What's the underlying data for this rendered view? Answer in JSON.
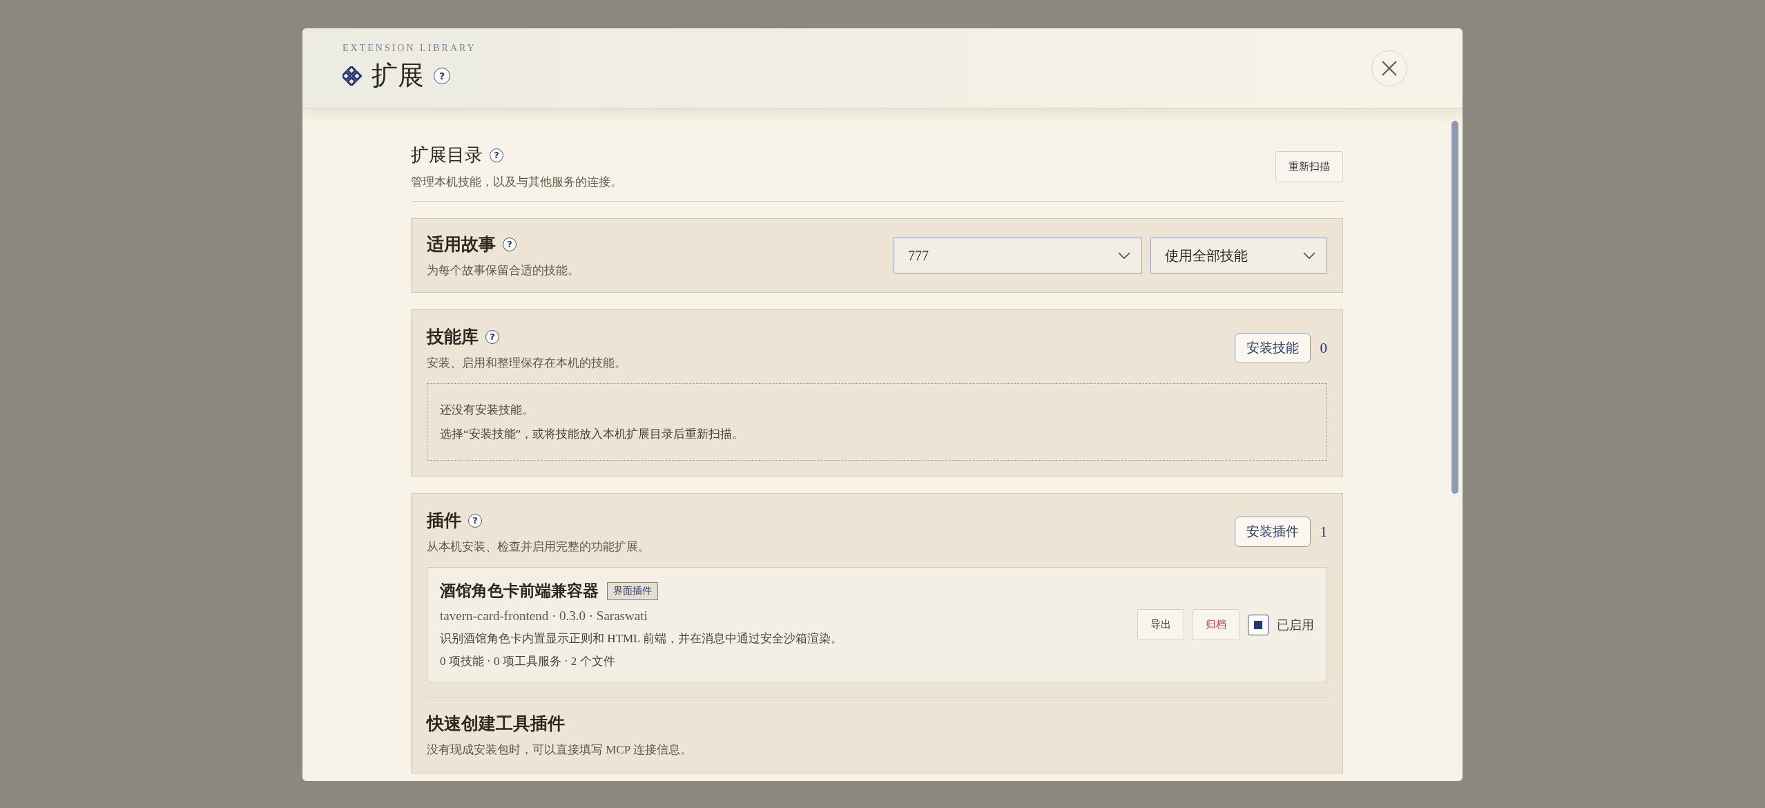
{
  "header": {
    "eyebrow": "EXTENSION LIBRARY",
    "title": "扩展",
    "help": "?"
  },
  "catalog": {
    "title": "扩展目录",
    "help": "?",
    "subtitle": "管理本机技能，以及与其他服务的连接。",
    "rescan_button": "重新扫描"
  },
  "story": {
    "title": "适用故事",
    "help": "?",
    "subtitle": "为每个故事保留合适的技能。",
    "selects": [
      {
        "value": "777"
      },
      {
        "value": "使用全部技能"
      }
    ]
  },
  "skills": {
    "title": "技能库",
    "help": "?",
    "subtitle": "安装、启用和整理保存在本机的技能。",
    "install_button": "安装技能",
    "count": "0",
    "empty": [
      "还没有安装技能。",
      "选择“安装技能”，或将技能放入本机扩展目录后重新扫描。"
    ]
  },
  "plugins": {
    "title": "插件",
    "help": "?",
    "subtitle": "从本机安装、检查并启用完整的功能扩展。",
    "install_button": "安装插件",
    "count": "1",
    "items": [
      {
        "name": "酒馆角色卡前端兼容器",
        "tag": "界面插件",
        "meta": "tavern-card-frontend · 0.3.0 · Saraswati",
        "description": "识别酒馆角色卡内置显示正则和 HTML 前端，并在消息中通过安全沙箱渲染。",
        "stats": "0 项技能 · 0 项工具服务 · 2 个文件",
        "actions": [
          {
            "label": "导出",
            "kind": "normal"
          },
          {
            "label": "归档",
            "kind": "danger"
          }
        ],
        "enabled": true,
        "status": "已启用"
      }
    ]
  },
  "quick_create": {
    "title": "快速创建工具插件",
    "subtitle": "没有现成安装包时，可以直接填写 MCP 连接信息。"
  }
}
